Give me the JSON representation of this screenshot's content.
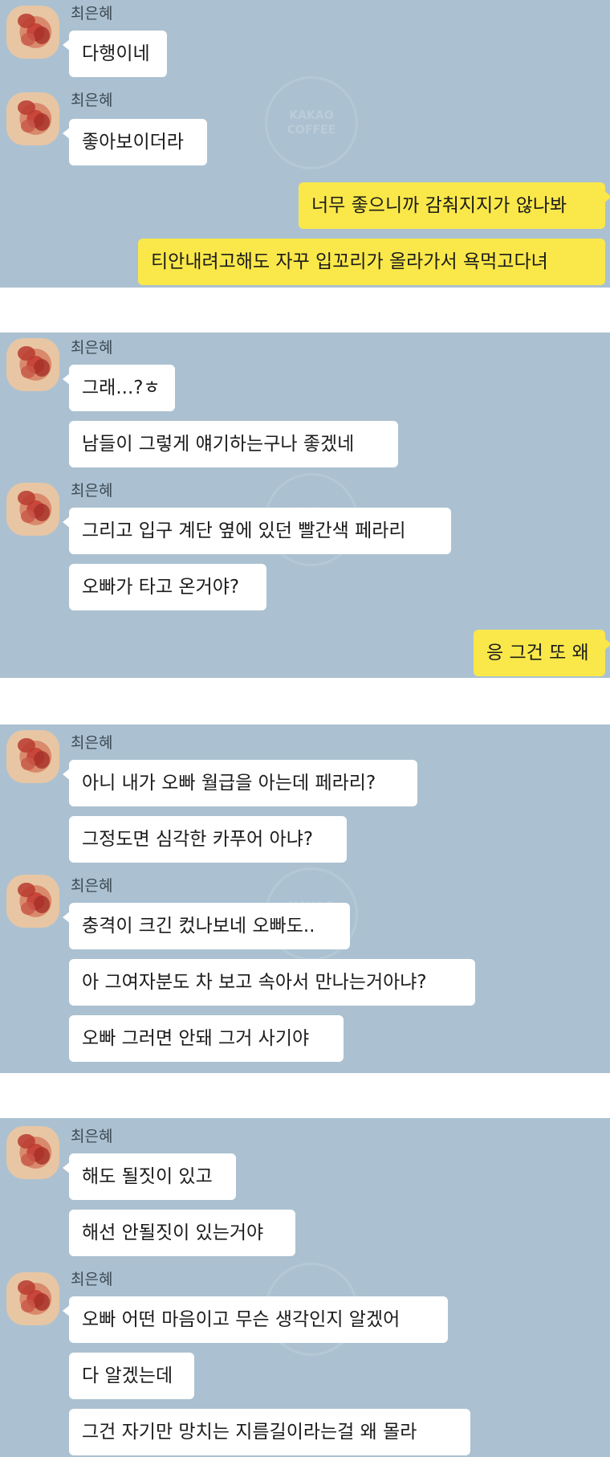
{
  "contact": {
    "name": "최은혜"
  },
  "panel1": {
    "group1": [
      "다행이네"
    ],
    "group2": [
      "좋아보이더라"
    ],
    "mine": [
      "너무 좋으니까 감춰지지가 않나봐",
      "티안내려고해도 자꾸 입꼬리가 올라가서 욕먹고다녀"
    ]
  },
  "panel2": {
    "group1": [
      "그래...?ㅎ",
      "남들이 그렇게 얘기하는구나 좋겠네"
    ],
    "group2": [
      "그리고 입구 계단 옆에 있던 빨간색 페라리",
      "오빠가 타고 온거야?"
    ],
    "mine": [
      "응 그건 또 왜"
    ]
  },
  "panel3": {
    "group1": [
      "아니 내가 오빠 월급을 아는데 페라리?",
      "그정도면 심각한 카푸어 아냐?"
    ],
    "group2": [
      "충격이 크긴 컸나보네 오빠도..",
      "아 그여자분도 차 보고 속아서 만나는거아냐?",
      "오빠 그러면 안돼 그거 사기야"
    ]
  },
  "panel4": {
    "group1": [
      "해도 될짓이 있고",
      "해선 안될짓이 있는거야"
    ],
    "group2": [
      "오빠 어떤 마음이고 무슨 생각인지 알겠어",
      "다 알겠는데",
      "그건 자기만 망치는 지름길이라는걸 왜 몰라"
    ]
  },
  "watermark": {
    "line1": "KAKAO",
    "line2": "COFFEE"
  },
  "colors": {
    "chat_bg": "#abc1d1",
    "my_bubble": "#fae84a",
    "their_bubble": "#ffffff"
  }
}
